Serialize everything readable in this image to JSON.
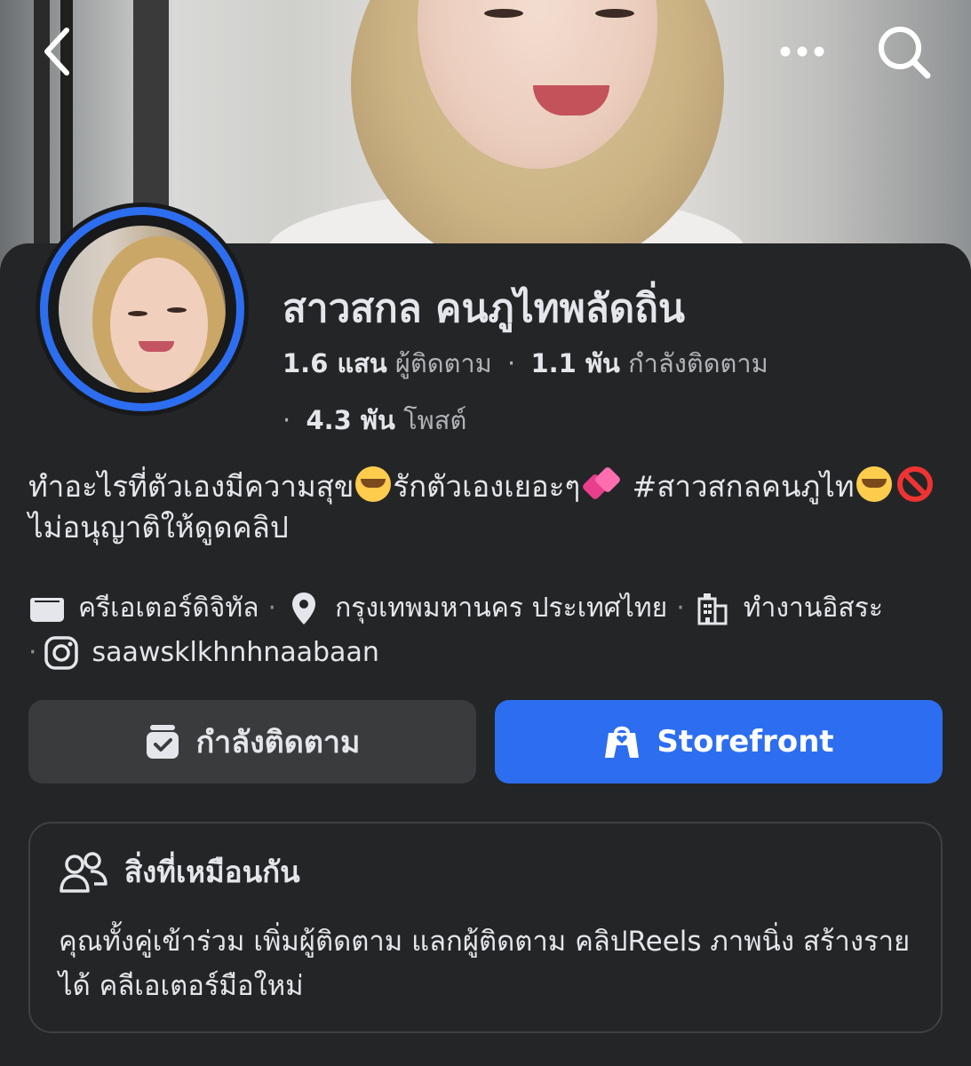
{
  "header": {
    "back_icon": "chevron-left-icon",
    "more_icon": "more-dots-icon",
    "search_icon": "search-icon"
  },
  "profile": {
    "name": "สาวสกล คนภูไทพลัดถิ่น",
    "followers_count": "1.6 แสน",
    "followers_label": "ผู้ติดตาม",
    "following_count": "1.1 พัน",
    "following_label": "กำลังติดตาม",
    "posts_count": "4.3 พัน",
    "posts_label": "โพสต์",
    "bio_part1": "ทำอะไรที่ตัวเองมีความสุข",
    "bio_part2": "รักตัวเองเยอะๆ",
    "bio_part3": " #สาวสกลคนภูไท",
    "bio_part4": "ไม่อนุญาติให้ดูดคลิป"
  },
  "details": {
    "category": "ครีเอเตอร์ดิจิทัล",
    "location": "กรุงเทพมหานคร ประเทศไทย",
    "work": "ทำงานอิสระ",
    "instagram": "saawsklkhnhnaabaan"
  },
  "actions": {
    "following_button": "กำลังติดตาม",
    "storefront_button": "Storefront"
  },
  "in_common": {
    "title": "สิ่งที่เหมือนกัน",
    "text": "คุณทั้งคู่เข้าร่วม เพิ่มผู้ติดตาม แลกผู้ติดตาม คลิปReels ภาพนิ่ง สร้างรายได้ คลีเอเตอร์มือใหม่"
  },
  "colors": {
    "background": "#242526",
    "accent": "#2d6ef0",
    "secondary_button": "#3a3b3c",
    "muted_text": "#b0b3b8"
  }
}
